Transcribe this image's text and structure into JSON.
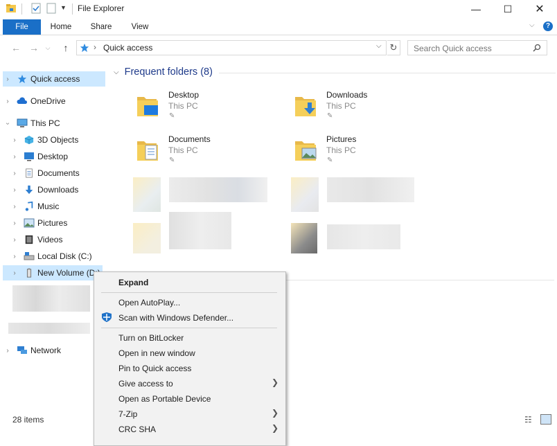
{
  "window": {
    "title": "File Explorer"
  },
  "ribbon": {
    "tabs": [
      "File",
      "Home",
      "Share",
      "View"
    ]
  },
  "address": {
    "location": "Quick access"
  },
  "search": {
    "placeholder": "Search Quick access"
  },
  "nav": {
    "items": [
      {
        "label": "Quick access",
        "icon": "star-icon"
      },
      {
        "label": "OneDrive",
        "icon": "cloud-icon"
      },
      {
        "label": "This PC",
        "icon": "computer-icon"
      },
      {
        "label": "3D Objects",
        "icon": "cube-icon"
      },
      {
        "label": "Desktop",
        "icon": "desktop-icon"
      },
      {
        "label": "Documents",
        "icon": "document-icon"
      },
      {
        "label": "Downloads",
        "icon": "download-icon"
      },
      {
        "label": "Music",
        "icon": "music-icon"
      },
      {
        "label": "Pictures",
        "icon": "picture-icon"
      },
      {
        "label": "Videos",
        "icon": "video-icon"
      },
      {
        "label": "Local Disk (C:)",
        "icon": "drive-icon"
      },
      {
        "label": "New Volume (D:)",
        "icon": "usb-drive-icon"
      },
      {
        "label": "Network",
        "icon": "network-icon"
      }
    ]
  },
  "content": {
    "group_title": "Frequent folders (8)",
    "folders": [
      {
        "name": "Desktop",
        "location": "This PC"
      },
      {
        "name": "Downloads",
        "location": "This PC"
      },
      {
        "name": "Documents",
        "location": "This PC"
      },
      {
        "name": "Pictures",
        "location": "This PC"
      }
    ]
  },
  "status": {
    "items": "28 items"
  },
  "context_menu": {
    "items": [
      "Expand",
      "Open AutoPlay...",
      "Scan with Windows Defender...",
      "Turn on BitLocker",
      "Open in new window",
      "Pin to Quick access",
      "Give access to",
      "Open as Portable Device",
      "7-Zip",
      "CRC SHA"
    ]
  },
  "colors": {
    "accent": "#1a6fc7",
    "selection": "#cce8ff",
    "folder": "#f5cf5a"
  }
}
